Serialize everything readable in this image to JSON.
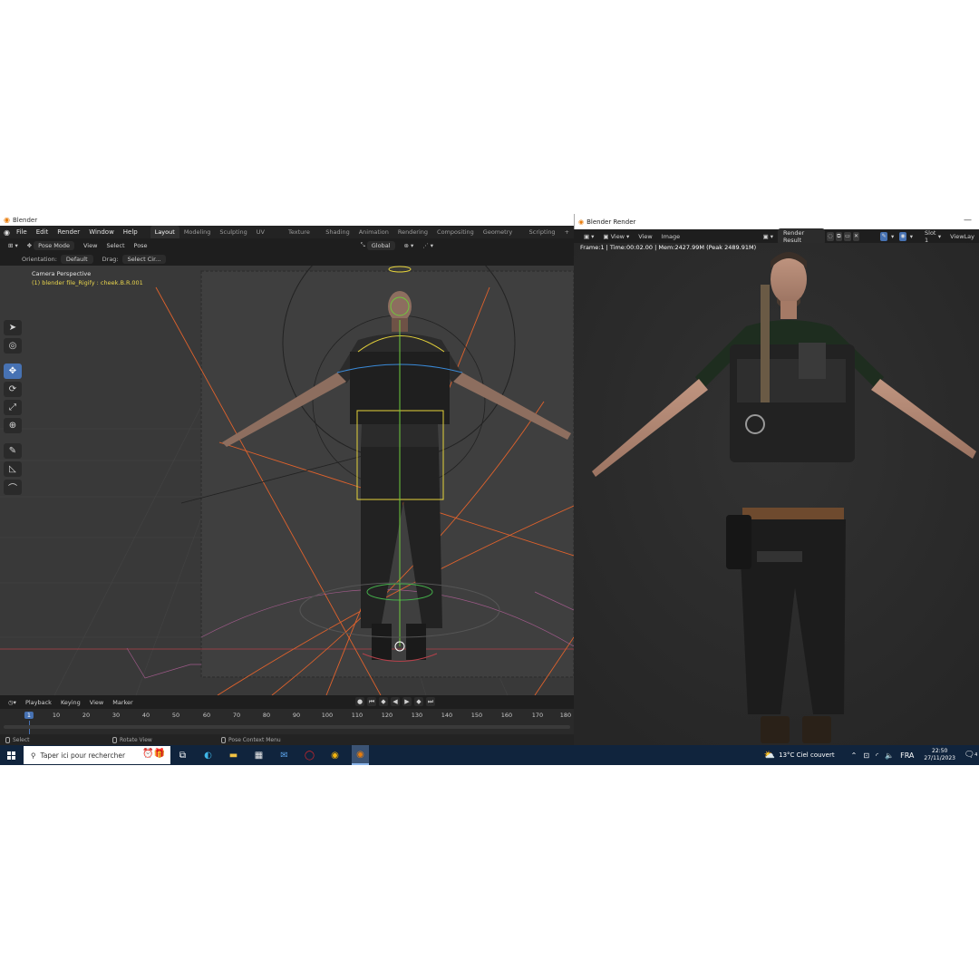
{
  "blender": {
    "window_title": "Blender",
    "menu": [
      "File",
      "Edit",
      "Render",
      "Window",
      "Help"
    ],
    "workspaces": [
      "Layout",
      "Modeling",
      "Sculpting",
      "UV Editing",
      "Texture Paint",
      "Shading",
      "Animation",
      "Rendering",
      "Compositing",
      "Geometry Nodes",
      "Scripting"
    ],
    "add_workspace": "+",
    "header": {
      "mode": "Pose Mode",
      "view": "View",
      "select": "Select",
      "pose": "Pose",
      "transform_orientation": "Global"
    },
    "tool_settings": {
      "orientation_label": "Orientation:",
      "orientation_value": "Default",
      "drag_label": "Drag:",
      "drag_value": "Select Cir..."
    },
    "viewport": {
      "camera_label": "Camera Perspective",
      "object_label": "(1) blender file_Rigify : cheek.B.R.001"
    },
    "timeline": {
      "menu": [
        "Playback",
        "Keying",
        "View",
        "Marker"
      ],
      "current_frame": "1",
      "ticks": [
        "10",
        "20",
        "30",
        "40",
        "50",
        "60",
        "70",
        "80",
        "90",
        "100",
        "110",
        "120",
        "130",
        "140",
        "150",
        "160",
        "170",
        "180"
      ]
    },
    "status": {
      "select": "Select",
      "rotate": "Rotate View",
      "context": "Pose Context Menu"
    }
  },
  "render_window": {
    "title": "Blender Render",
    "view": "View",
    "view2": "View",
    "image": "Image",
    "result": "Render Result",
    "slot": "Slot 1",
    "viewlayer": "ViewLay",
    "info": "Frame:1 | Time:00:02.00 | Mem:2427.99M (Peak 2489.91M)"
  },
  "taskbar": {
    "search_placeholder": "Taper ici pour rechercher",
    "weather": "13°C  Ciel couvert",
    "language": "FRA",
    "time": "22:50",
    "date": "27/11/2023",
    "notification_count": "4"
  },
  "colors": {
    "accent": "#4772b3",
    "blender_orange": "#e87d0d",
    "taskbar": "#10243d",
    "object_label": "#e8d44d"
  }
}
